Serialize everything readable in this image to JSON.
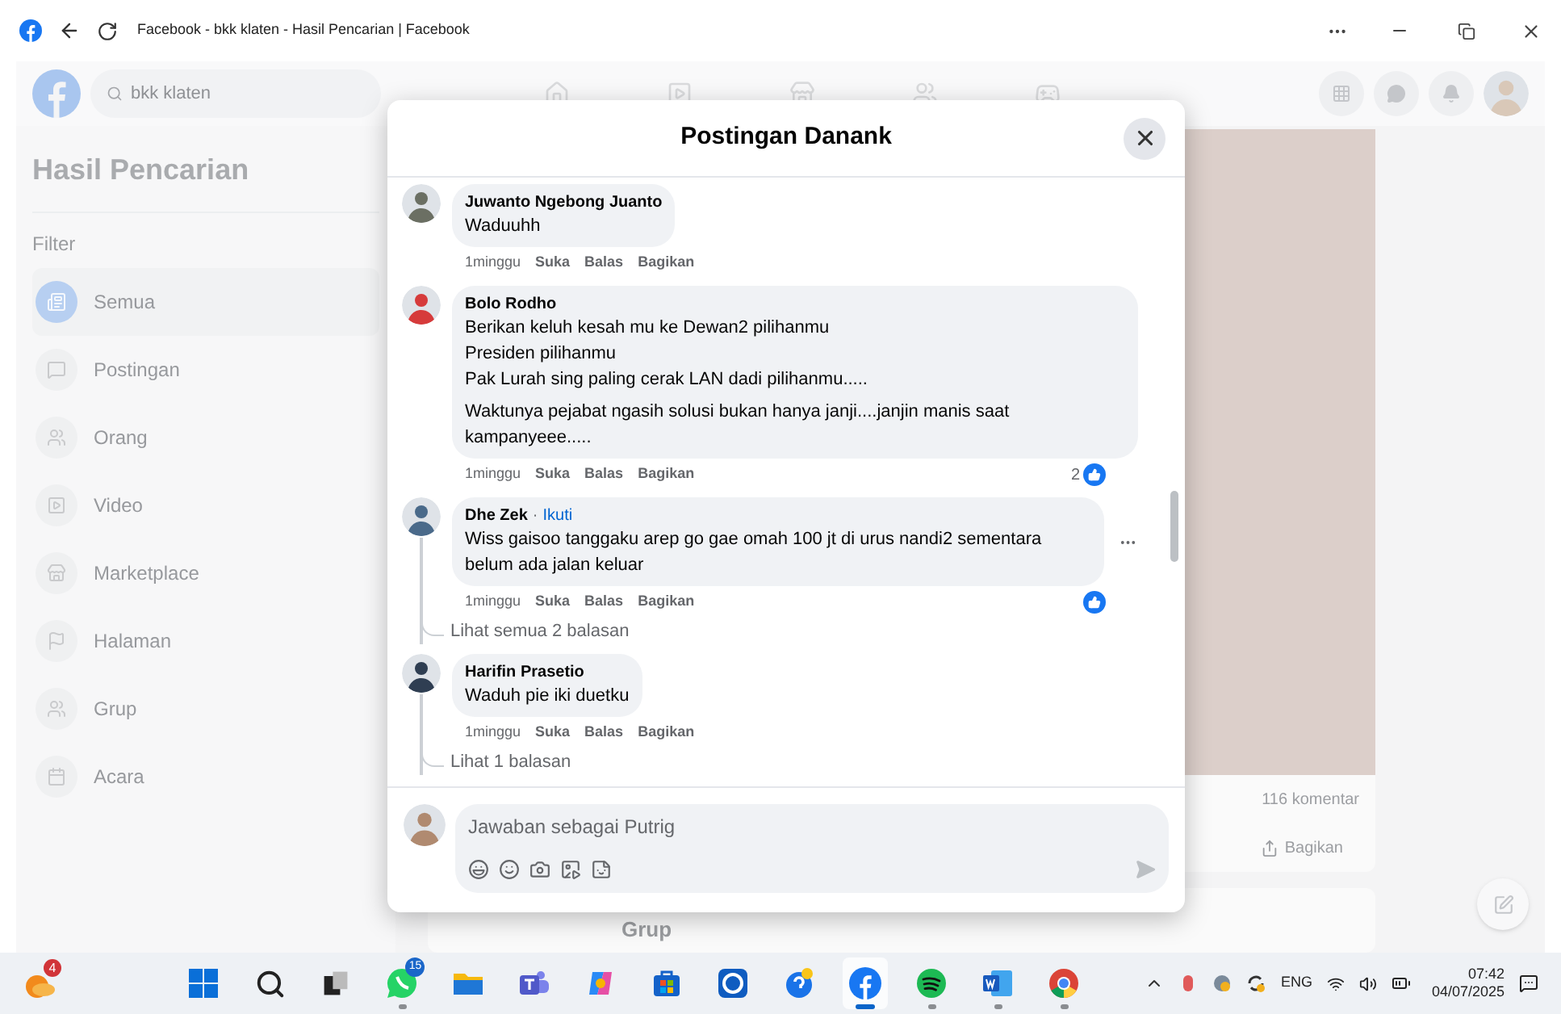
{
  "browser": {
    "title": "Facebook - bkk klaten - Hasil Pencarian | Facebook"
  },
  "search": {
    "value": "bkk klaten"
  },
  "sidebar": {
    "title": "Hasil Pencarian",
    "filter_label": "Filter",
    "items": [
      {
        "label": "Semua",
        "kind": "all",
        "selected": true
      },
      {
        "label": "Postingan",
        "kind": "posts",
        "selected": false
      },
      {
        "label": "Orang",
        "kind": "people",
        "selected": false
      },
      {
        "label": "Video",
        "kind": "video",
        "selected": false
      },
      {
        "label": "Marketplace",
        "kind": "marketplace",
        "selected": false
      },
      {
        "label": "Halaman",
        "kind": "pages",
        "selected": false
      },
      {
        "label": "Grup",
        "kind": "groups",
        "selected": false
      },
      {
        "label": "Acara",
        "kind": "events",
        "selected": false
      }
    ]
  },
  "background_post": {
    "comment_count": "116 komentar",
    "share": "Bagikan",
    "next_section": "Grup"
  },
  "modal": {
    "title": "Postingan Danank",
    "comments": [
      {
        "author": "Juwanto Ngebong Juanto",
        "paragraphs": [
          [
            "Waduuhh"
          ]
        ],
        "time": "1minggu",
        "actions": [
          "Suka",
          "Balas",
          "Bagikan"
        ],
        "has_reaction": false,
        "thread": false
      },
      {
        "author": "Bolo Rodho",
        "paragraphs": [
          [
            "Berikan keluh kesah mu ke Dewan2 pilihanmu",
            "Presiden pilihanmu",
            "Pak Lurah sing paling cerak LAN dadi pilihanmu....."
          ],
          [
            "Waktunya pejabat ngasih solusi bukan hanya janji....janjin manis saat kampanyeee....."
          ]
        ],
        "time": "1minggu",
        "actions": [
          "Suka",
          "Balas",
          "Bagikan"
        ],
        "has_reaction": true,
        "reaction_count": "2",
        "thread": false
      },
      {
        "author": "Dhe Zek",
        "follow_separator": "·",
        "follow": "Ikuti",
        "paragraphs": [
          [
            "Wiss gaisoo tanggaku arep go gae omah 100 jt di urus nandi2 sementara belum ada jalan keluar"
          ]
        ],
        "time": "1minggu",
        "actions": [
          "Suka",
          "Balas",
          "Bagikan"
        ],
        "has_reaction": true,
        "thread": true,
        "replies_link": "Lihat semua 2 balasan"
      },
      {
        "author": "Harifin Prasetio",
        "paragraphs": [
          [
            "Waduh pie iki duetku"
          ]
        ],
        "time": "1minggu",
        "actions": [
          "Suka",
          "Balas",
          "Bagikan"
        ],
        "has_reaction": false,
        "thread": true,
        "replies_link": "Lihat 1 balasan"
      }
    ],
    "composer": {
      "placeholder": "Jawaban sebagai Putrig"
    }
  },
  "taskbar": {
    "weather_badge": "4",
    "apps": [
      {
        "kind": "start",
        "selected": false,
        "running": false
      },
      {
        "kind": "search",
        "selected": false,
        "running": false
      },
      {
        "kind": "taskview",
        "selected": false,
        "running": false
      },
      {
        "kind": "whatsapp",
        "badge": "15",
        "selected": false,
        "running": true
      },
      {
        "kind": "files",
        "selected": false,
        "running": false
      },
      {
        "kind": "teams",
        "selected": false,
        "running": false
      },
      {
        "kind": "copilot",
        "selected": false,
        "running": false
      },
      {
        "kind": "store",
        "selected": false,
        "running": false
      },
      {
        "kind": "app",
        "selected": false,
        "running": false
      },
      {
        "kind": "help",
        "selected": false,
        "running": false
      },
      {
        "kind": "facebook",
        "selected": true,
        "running": true
      },
      {
        "kind": "spotify",
        "selected": false,
        "running": true
      },
      {
        "kind": "word",
        "selected": false,
        "running": true
      },
      {
        "kind": "chrome",
        "selected": false,
        "running": true
      }
    ],
    "language": "ENG",
    "time": "07:42",
    "date": "04/07/2025"
  }
}
